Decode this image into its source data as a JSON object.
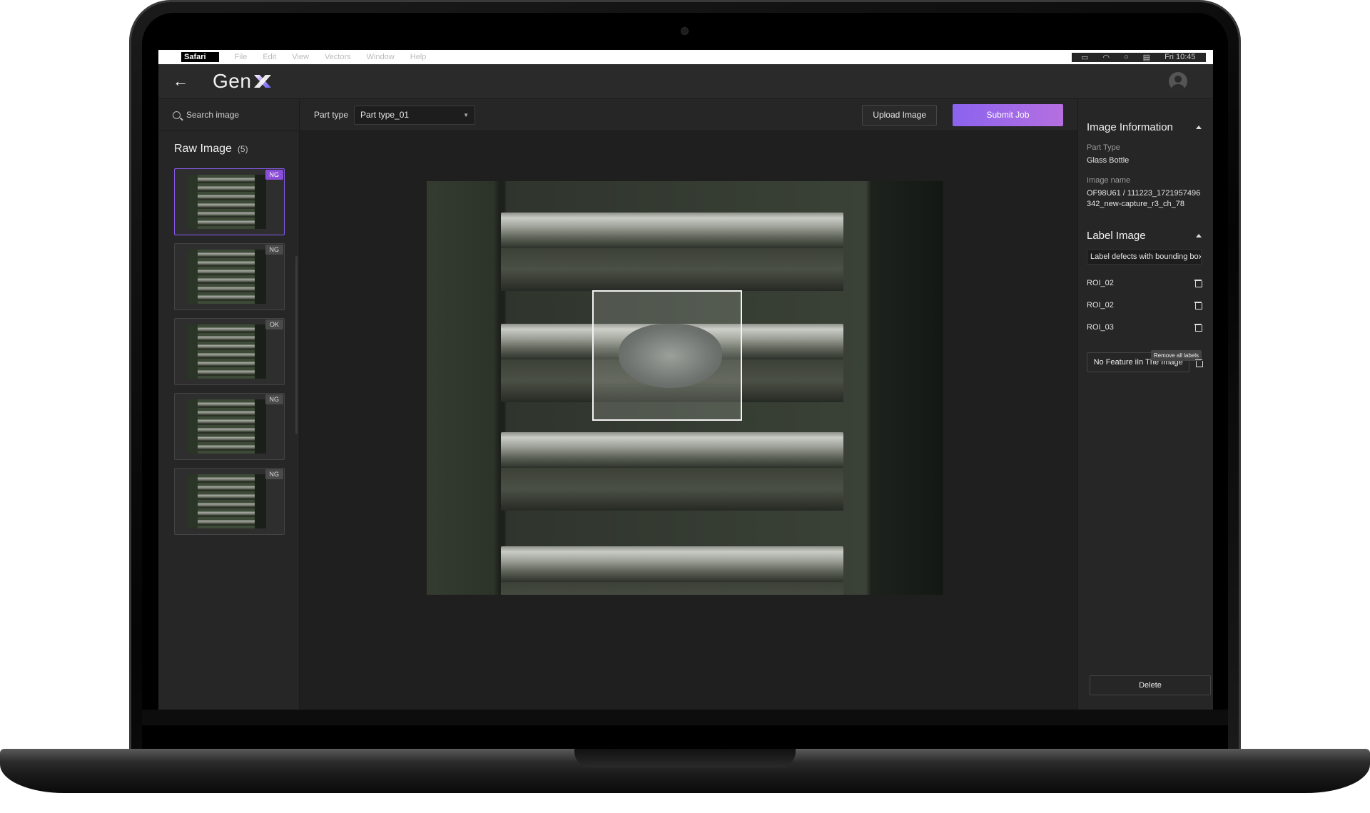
{
  "menubar": {
    "app": "Safari",
    "items": [
      "File",
      "Edit",
      "View",
      "Vectors",
      "Window",
      "Help"
    ],
    "clock": "Fri 10:45"
  },
  "header": {
    "logo": "Gen",
    "back": "←"
  },
  "sidebar": {
    "search_placeholder": "Search image",
    "title": "Raw Image",
    "count": "(5)",
    "thumbnails": [
      {
        "badge": "NG",
        "selected": true
      },
      {
        "badge": "NG",
        "selected": false
      },
      {
        "badge": "OK",
        "selected": false
      },
      {
        "badge": "NG",
        "selected": false
      },
      {
        "badge": "NG",
        "selected": false
      }
    ]
  },
  "toolbar": {
    "part_type_label": "Part type",
    "part_type_value": "Part type_01",
    "upload_label": "Upload Image",
    "submit_label": "Submit Job"
  },
  "info": {
    "title": "Image Information",
    "part_type_label": "Part Type",
    "part_type_value": "Glass Bottle",
    "image_name_label": "Image name",
    "image_name_value": "OF98U61 / 111223_1721957496342_new-capture_r3_ch_78"
  },
  "label": {
    "title": "Label Image",
    "hint": "Label defects with bounding box",
    "rois": [
      "ROI_02",
      "ROI_02",
      "ROI_03"
    ],
    "tooltip": "Remove all labels",
    "no_feature": "No Feature iIn The Image",
    "delete": "Delete"
  },
  "colors": {
    "accent_start": "#8b63ee",
    "accent_end": "#b56fe0",
    "panel": "#262626"
  }
}
